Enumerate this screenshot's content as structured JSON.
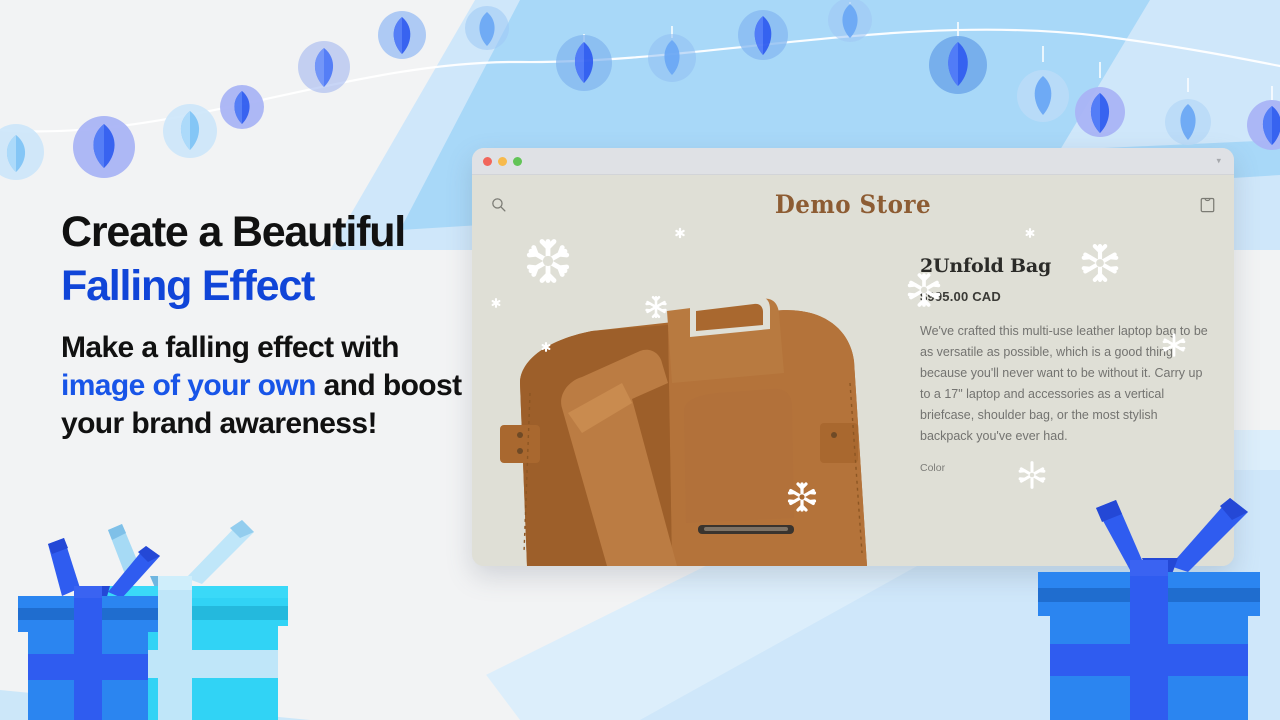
{
  "page": {
    "background_color": "#f2f3f4",
    "accent_blue": "#1045d8"
  },
  "copy": {
    "headline_line1": "Create a Beautiful",
    "headline_line2": "Falling Effect",
    "sub_line1": "Make a falling effect with",
    "sub_highlight": "image of your own",
    "sub_line2": " and",
    "sub_line3": "boost your brand",
    "sub_line4": "awareness!"
  },
  "browser": {
    "traffic_lights": [
      "close-red",
      "minimize-yellow",
      "maximize-green"
    ],
    "chevron_icon": "chevron-down-icon"
  },
  "store": {
    "title": "Demo Store",
    "title_color": "#8d5c33",
    "search_icon": "search-icon",
    "cart_icon": "shopping-bag-icon",
    "product": {
      "name": "2Unfold Bag",
      "price": "$995.00 CAD",
      "description": "We've crafted this multi-use leather laptop bag to be as versatile as possible, which is a good thing because you'll never want to be without it. Carry up to a 17\" laptop and accessories as a vertical briefcase, shoulder bag, or the most stylish backpack you've ever had.",
      "option_label": "Color",
      "image_alt": "brown-leather-laptop-bag"
    }
  },
  "decorations": {
    "garland_label": "hanging-lantern-garland",
    "gift_left_label": "gift-boxes-left",
    "gift_right_label": "gift-box-right",
    "snowflake_label": "falling-snowflakes"
  }
}
